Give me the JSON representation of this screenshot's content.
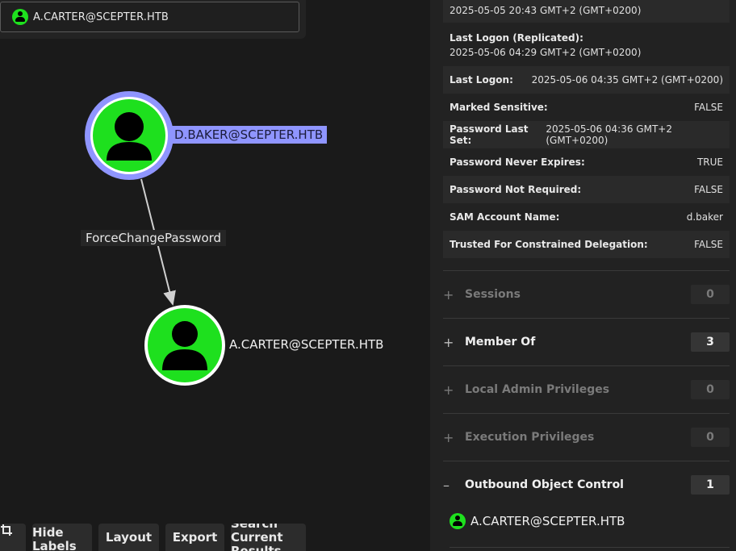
{
  "search": {
    "value": "A.CARTER@SCEPTER.HTB"
  },
  "graph": {
    "nodes": [
      {
        "id": "dbaker",
        "label": "D.BAKER@SCEPTER.HTB",
        "selected": true,
        "icon": "user-icon"
      },
      {
        "id": "acarter",
        "label": "A.CARTER@SCEPTER.HTB",
        "selected": false,
        "icon": "user-icon"
      }
    ],
    "edge": {
      "from": "dbaker",
      "to": "acarter",
      "label": "ForceChangePassword"
    }
  },
  "toolbar": {
    "crop_icon": "crop-icon",
    "hide_labels": [
      "Hide",
      "Labels"
    ],
    "layout": "Layout",
    "export": "Export",
    "search_results": [
      "Search",
      "Current",
      "Results"
    ]
  },
  "properties": {
    "top_partial_value": "2025-05-05 20:43 GMT+2 (GMT+0200)",
    "last_logon_replicated_label": "Last Logon (Replicated):",
    "last_logon_replicated_value": "2025-05-06 04:29 GMT+2 (GMT+0200)",
    "rows": [
      {
        "label": "Last Logon:",
        "value": "2025-05-06 04:35 GMT+2 (GMT+0200)"
      },
      {
        "label": "Marked Sensitive:",
        "value": "FALSE"
      },
      {
        "label": "Password Last Set:",
        "value": "2025-05-06 04:36 GMT+2 (GMT+0200)"
      },
      {
        "label": "Password Never Expires:",
        "value": "TRUE"
      },
      {
        "label": "Password Not Required:",
        "value": "FALSE"
      },
      {
        "label": "SAM Account Name:",
        "value": "d.baker"
      },
      {
        "label": "Trusted For Constrained Delegation:",
        "value": "FALSE"
      }
    ]
  },
  "sections": [
    {
      "title": "Sessions",
      "count": "0",
      "toggle": "+",
      "disabled": true
    },
    {
      "title": "Member Of",
      "count": "3",
      "toggle": "+",
      "disabled": false
    },
    {
      "title": "Local Admin Privileges",
      "count": "0",
      "toggle": "+",
      "disabled": true
    },
    {
      "title": "Execution Privileges",
      "count": "0",
      "toggle": "+",
      "disabled": true
    },
    {
      "title": "Outbound Object Control",
      "count": "1",
      "toggle": "–",
      "disabled": false
    }
  ],
  "outbound_items": [
    {
      "label": "A.CARTER@SCEPTER.HTB"
    }
  ],
  "colors": {
    "node_fill": "#1ee01e",
    "selected_ring": "#8f95ff",
    "panel_bg": "#222222",
    "canvas_bg": "#1a1a1a"
  }
}
